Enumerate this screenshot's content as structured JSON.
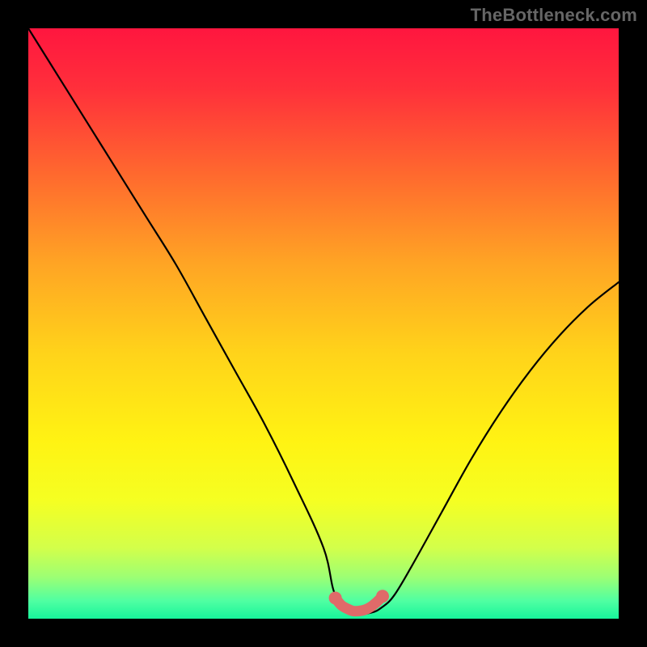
{
  "watermark": "TheBottleneck.com",
  "chart_data": {
    "type": "line",
    "title": "",
    "xlabel": "",
    "ylabel": "",
    "xlim": [
      0,
      100
    ],
    "ylim": [
      0,
      100
    ],
    "series": [
      {
        "name": "bottleneck-curve",
        "x": [
          0,
          5,
          10,
          15,
          20,
          25,
          30,
          35,
          40,
          45,
          50,
          52,
          55,
          58,
          60,
          62,
          65,
          70,
          75,
          80,
          85,
          90,
          95,
          100
        ],
        "values": [
          100,
          92,
          84,
          76,
          68,
          60,
          51,
          42,
          33,
          23,
          12,
          4,
          1,
          1,
          2,
          4,
          9,
          18,
          27,
          35,
          42,
          48,
          53,
          57
        ]
      },
      {
        "name": "optimal-zone",
        "x": [
          52,
          53,
          54,
          55,
          56,
          57,
          58,
          59,
          60
        ],
        "values": [
          3.5,
          2.3,
          1.7,
          1.3,
          1.3,
          1.5,
          2.0,
          2.8,
          3.8
        ]
      }
    ],
    "gradient_stops": [
      {
        "pct": 0,
        "color": "#ff163f"
      },
      {
        "pct": 10,
        "color": "#ff2f3b"
      },
      {
        "pct": 25,
        "color": "#ff6a2e"
      },
      {
        "pct": 40,
        "color": "#ffa524"
      },
      {
        "pct": 55,
        "color": "#ffd31a"
      },
      {
        "pct": 70,
        "color": "#fff313"
      },
      {
        "pct": 80,
        "color": "#f5ff22"
      },
      {
        "pct": 88,
        "color": "#d3ff4a"
      },
      {
        "pct": 93,
        "color": "#9cff74"
      },
      {
        "pct": 97,
        "color": "#4fffa2"
      },
      {
        "pct": 100,
        "color": "#17f59b"
      }
    ],
    "colors": {
      "curve": "#000000",
      "optimal_zone": "#e06a69",
      "frame": "#000000"
    }
  }
}
